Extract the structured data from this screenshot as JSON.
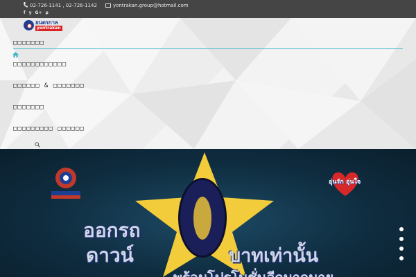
{
  "topbar": {
    "phone": "02-726-1141 , 02-726-1142",
    "email": "yontrakan.group@hotmail.com",
    "socials": [
      "f",
      "y",
      "G+",
      "p"
    ]
  },
  "logo": {
    "thai": "ยนตรกาล",
    "latin": "yontrakan"
  },
  "menu": {
    "items": [
      "□□□□□□□",
      "□□□□□□□□□□□□",
      "□□□□□□ & □□□□□□□",
      "□□□□□□□",
      "□□□□□□□□□ □□□□□□"
    ]
  },
  "banner": {
    "line1": "ออกรถ",
    "line2": "ดาวน์",
    "line3": "บาทเท่านั้น",
    "line4": "พร้อมโปรโมชั่นอีกมากมาย",
    "badge": "อุ่นรัก อุ่นใจ",
    "slide_count": 4,
    "active_slide": 1
  },
  "colors": {
    "accent": "#3fb7c6",
    "brand": "#1c3f94",
    "topbar": "#454545"
  }
}
